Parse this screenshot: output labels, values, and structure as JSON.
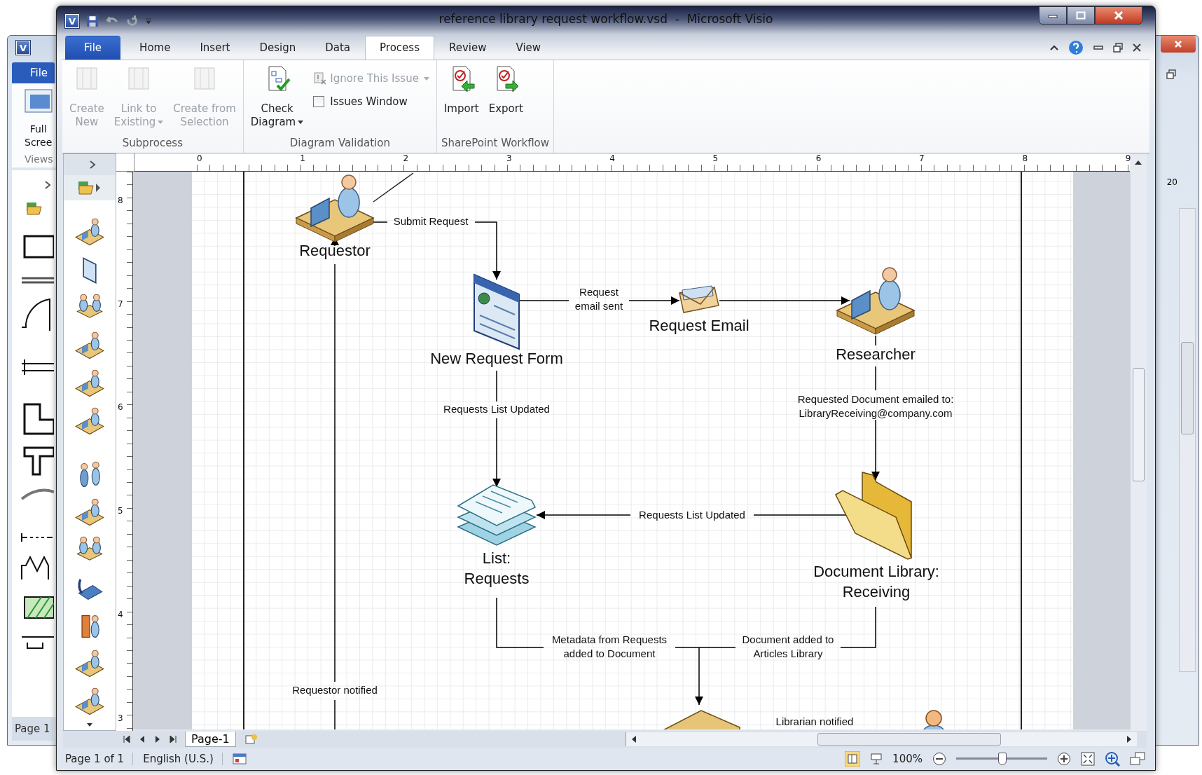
{
  "back_window": {
    "logo_letter": "V",
    "tab": "File",
    "button_lines": [
      "Full",
      "Scree"
    ],
    "group": "Views",
    "page_tab": "Page 1",
    "ruler_label": "20"
  },
  "window": {
    "logo_letter": "V",
    "title": "reference library request workflow.vsd  -  Microsoft Visio"
  },
  "tabs": [
    {
      "label": "File",
      "kind": "file",
      "selected": false
    },
    {
      "label": "Home",
      "kind": "tab",
      "selected": false
    },
    {
      "label": "Insert",
      "kind": "tab",
      "selected": false
    },
    {
      "label": "Design",
      "kind": "tab",
      "selected": false
    },
    {
      "label": "Data",
      "kind": "tab",
      "selected": false
    },
    {
      "label": "Process",
      "kind": "tab",
      "selected": true
    },
    {
      "label": "Review",
      "kind": "tab",
      "selected": false
    },
    {
      "label": "View",
      "kind": "tab",
      "selected": false
    }
  ],
  "ribbon_groups": [
    {
      "label": "Subprocess",
      "buttons": [
        {
          "kind": "large",
          "lines": [
            "Create",
            "New"
          ],
          "disabled": true,
          "dropdown": false
        },
        {
          "kind": "large",
          "lines": [
            "Link to",
            "Existing"
          ],
          "disabled": true,
          "dropdown": true
        },
        {
          "kind": "large",
          "lines": [
            "Create from",
            "Selection"
          ],
          "disabled": true,
          "dropdown": false
        }
      ]
    },
    {
      "label": "Diagram Validation",
      "buttons": [
        {
          "kind": "large",
          "lines": [
            "Check",
            "Diagram"
          ],
          "disabled": false,
          "dropdown": true
        },
        {
          "kind": "small",
          "lines": [
            "Ignore This Issue"
          ],
          "disabled": true,
          "dropdown": true
        },
        {
          "kind": "checkbox",
          "lines": [
            "Issues Window"
          ],
          "checked": false
        }
      ]
    },
    {
      "label": "SharePoint Workflow",
      "buttons": [
        {
          "kind": "large",
          "lines": [
            "Import"
          ],
          "disabled": false,
          "dropdown": false
        },
        {
          "kind": "large",
          "lines": [
            "Export"
          ],
          "disabled": false,
          "dropdown": false
        }
      ]
    }
  ],
  "h_ruler": [
    "0",
    "1",
    "2",
    "3",
    "4",
    "5",
    "6",
    "7",
    "8",
    "9"
  ],
  "v_ruler": [
    "8",
    "7",
    "6",
    "5",
    "4",
    "3"
  ],
  "diagram": {
    "nodes": [
      {
        "kind": "desk-person",
        "label_lines": [
          "Requestor"
        ]
      },
      {
        "kind": "web-form",
        "label_lines": [
          "New Request Form"
        ]
      },
      {
        "kind": "envelope",
        "label_lines": [
          "Request Email"
        ]
      },
      {
        "kind": "desk-person",
        "label_lines": [
          "Researcher"
        ]
      },
      {
        "kind": "document-stack",
        "label_lines": [
          "List:",
          "Requests"
        ]
      },
      {
        "kind": "folder",
        "label_lines": [
          "Document Library:",
          "Receiving"
        ]
      },
      {
        "kind": "box"
      },
      {
        "kind": "person"
      }
    ],
    "connector_labels": [
      {
        "lines": [
          "Submit Request"
        ]
      },
      {
        "lines": [
          "Request",
          "email sent"
        ]
      },
      {
        "lines": [
          "Requests List Updated"
        ]
      },
      {
        "lines": [
          "Requested Document emailed to:",
          "LibraryReceiving@company.com"
        ]
      },
      {
        "lines": [
          "Requests List Updated"
        ]
      },
      {
        "lines": [
          "Metadata from Requests",
          "added to Document"
        ]
      },
      {
        "lines": [
          "Document added to",
          "Articles Library"
        ]
      },
      {
        "lines": [
          "Requestor notified"
        ]
      },
      {
        "lines": [
          "Librarian notified"
        ]
      }
    ]
  },
  "page_tabs": [
    {
      "label": "Page-1",
      "selected": true
    }
  ],
  "status_bar": {
    "page": "Page 1 of 1",
    "language": "English (U.S.)",
    "zoom": "100%",
    "zoom_slider": {
      "level": 0.5
    }
  }
}
